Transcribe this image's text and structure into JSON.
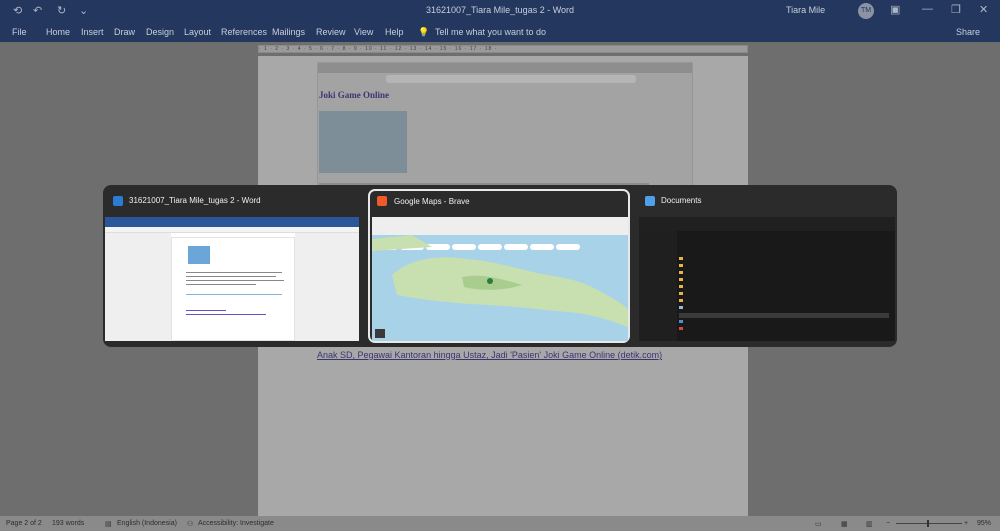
{
  "window": {
    "title": "31621007_Tiara Mile_tugas 2  -  Word",
    "user_name": "Tiara Mile",
    "user_initials": "TM"
  },
  "ribbon": {
    "tabs": [
      "File",
      "Home",
      "Insert",
      "Draw",
      "Design",
      "Layout",
      "References",
      "Mailings",
      "Review",
      "View",
      "Help"
    ],
    "tell_me": "Tell me what you want to do",
    "share": "Share"
  },
  "document": {
    "embedded_heading": "Joki Game Online",
    "link_text": "Anak SD, Pegawai Kantoran hingga Ustaz, Jadi 'Pasien' Joki Game Online (detik.com)"
  },
  "status": {
    "page": "Page 2 of 2",
    "words": "193 words",
    "language": "English (Indonesia)",
    "accessibility": "Accessibility: Investigate",
    "zoom": "95%"
  },
  "switcher": {
    "windows": [
      {
        "title": "31621007_Tiara Mile_tugas 2 - Word",
        "app": "word",
        "icon_color": "#2b7cd3",
        "active": false
      },
      {
        "title": "Google Maps - Brave",
        "app": "brave",
        "icon_color": "#f05a28",
        "active": true
      },
      {
        "title": "Documents",
        "app": "explorer",
        "icon_color": "#4ea0e8",
        "active": false
      }
    ]
  }
}
